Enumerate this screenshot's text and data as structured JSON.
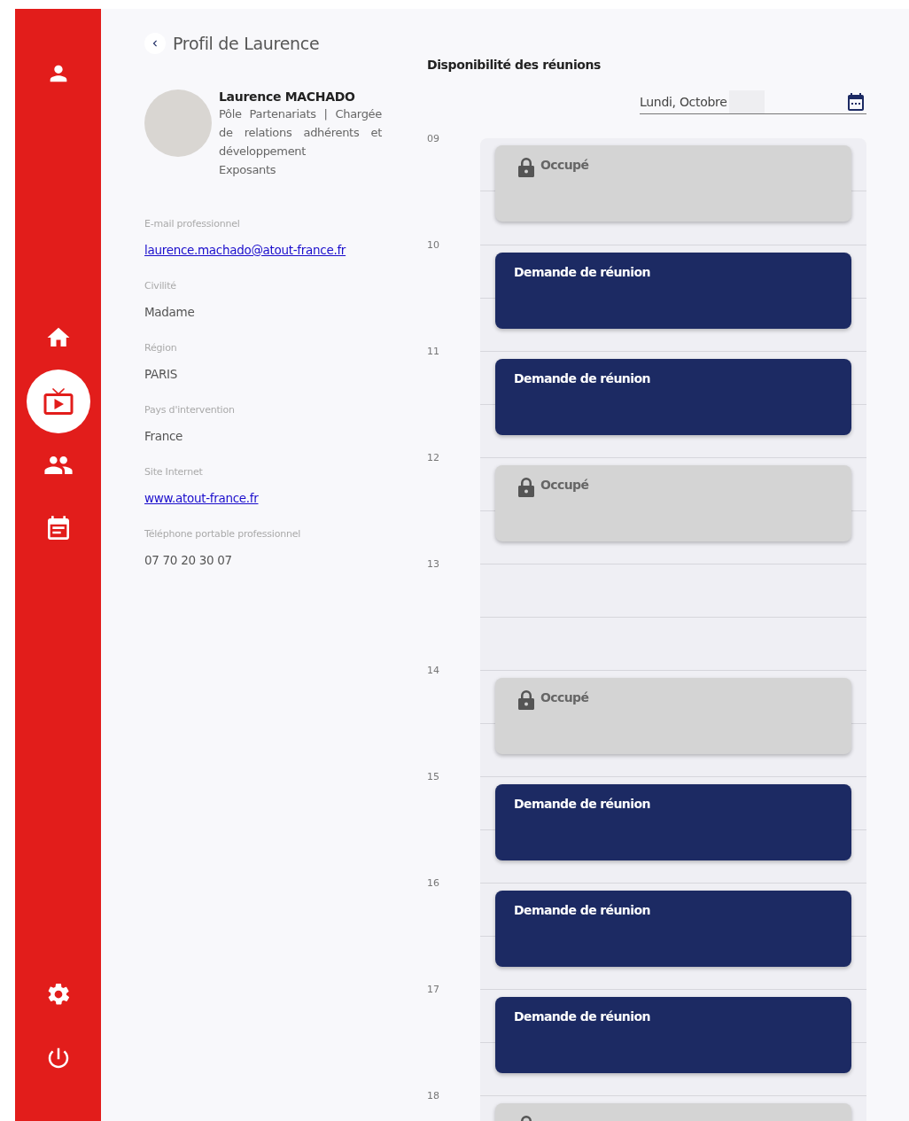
{
  "sidebar": {
    "top_items": [
      {
        "selected": false
      }
    ],
    "nav_items": [
      {
        "selected": false
      },
      {
        "selected": true
      },
      {
        "selected": false
      },
      {
        "selected": false
      }
    ],
    "bottom_items": [
      {
        "selected": false
      },
      {
        "selected": false
      }
    ]
  },
  "profile": {
    "title": "Profil de Laurence",
    "name": "Laurence MACHADO",
    "role": "Pôle Partenariats | Chargée de relations adhérents et développement",
    "department": "Exposants",
    "fields": [
      {
        "label": "E-mail professionnel",
        "value": "laurence.machado@atout-france.fr",
        "kind": "link"
      },
      {
        "label": "Civilité",
        "value": "Madame",
        "kind": "text"
      },
      {
        "label": "Région",
        "value": "PARIS",
        "kind": "text"
      },
      {
        "label": "Pays d'intervention",
        "value": "France",
        "kind": "text"
      },
      {
        "label": "Site Internet",
        "value": "www.atout-france.fr",
        "kind": "link"
      },
      {
        "label": "Téléphone portable professionnel",
        "value": "07 70 20 30 07",
        "kind": "text"
      }
    ]
  },
  "availability": {
    "title": "Disponibilité des réunions",
    "date_value": "Lundi, Octobre",
    "slots": [
      {
        "hour": "09",
        "event": {
          "kind": "busy",
          "label": "Occupé"
        }
      },
      {
        "hour": "10",
        "event": {
          "kind": "request",
          "label": "Demande de réunion"
        }
      },
      {
        "hour": "11",
        "event": {
          "kind": "request",
          "label": "Demande de réunion"
        }
      },
      {
        "hour": "12",
        "event": {
          "kind": "busy",
          "label": "Occupé"
        }
      },
      {
        "hour": "13"
      },
      {
        "hour": "14",
        "event": {
          "kind": "busy",
          "label": "Occupé"
        }
      },
      {
        "hour": "15",
        "event": {
          "kind": "request",
          "label": "Demande de réunion"
        }
      },
      {
        "hour": "16",
        "event": {
          "kind": "request",
          "label": "Demande de réunion"
        }
      },
      {
        "hour": "17",
        "event": {
          "kind": "request",
          "label": "Demande de réunion"
        }
      },
      {
        "hour": "18",
        "event": {
          "kind": "busy"
        }
      }
    ]
  }
}
